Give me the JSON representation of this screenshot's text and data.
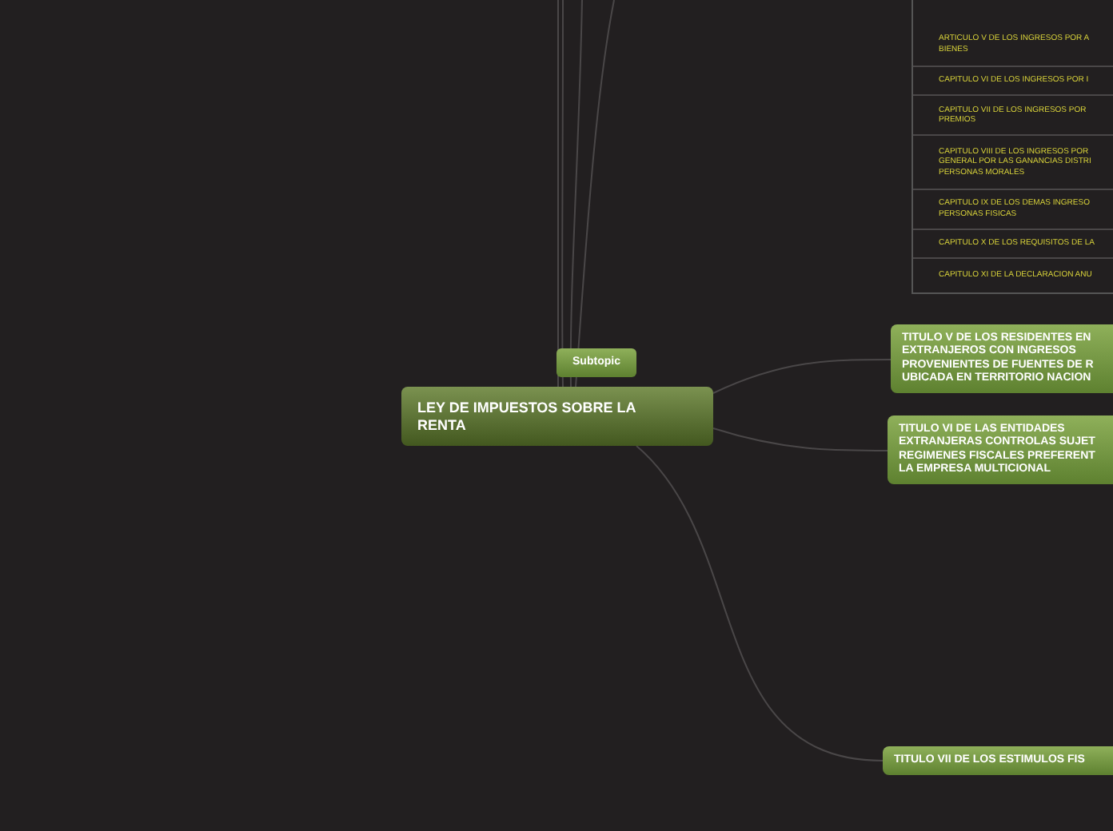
{
  "central_topic": {
    "lines": [
      "LEY DE IMPUESTOS SOBRE  LA",
      "RENTA"
    ]
  },
  "subtopic": {
    "text": "Subtopic"
  },
  "chapter_list": [
    {
      "lines": [
        "ARTICULO V DE LOS INGRESOS POR A",
        "BIENES"
      ]
    },
    {
      "lines": [
        "CAPITULO VI DE LOS INGRESOS POR I"
      ]
    },
    {
      "lines": [
        "CAPITULO VII DE LOS INGRESOS POR",
        "PREMIOS"
      ]
    },
    {
      "lines": [
        "CAPITULO VIII DE LOS INGRESOS POR",
        "GENERAL POR LAS GANANCIAS DISTRI",
        "PERSONAS MORALES"
      ]
    },
    {
      "lines": [
        "CAPITULO IX  DE LOS DEMAS INGRESO",
        "PERSONAS FISICAS"
      ]
    },
    {
      "lines": [
        "CAPITULO X DE LOS REQUISITOS DE LA"
      ]
    },
    {
      "lines": [
        "CAPITULO XI DE LA DECLARACION ANU"
      ]
    }
  ],
  "main_topics": [
    {
      "lines": [
        "TITULO V DE LOS RESIDENTES EN",
        "EXTRANJEROS CON INGRESOS",
        "PROVENIENTES DE FUENTES DE R",
        "UBICADA EN TERRITORIO NACION"
      ]
    },
    {
      "lines": [
        "TITULO VI DE LAS ENTIDADES",
        "EXTRANJERAS CONTROLAS SUJET",
        "REGIMENES FISCALES PREFERENT",
        "LA EMPRESA MULTICIONAL"
      ]
    },
    {
      "lines": [
        "TITULO VII DE LOS ESTIMULOS FIS"
      ]
    }
  ]
}
